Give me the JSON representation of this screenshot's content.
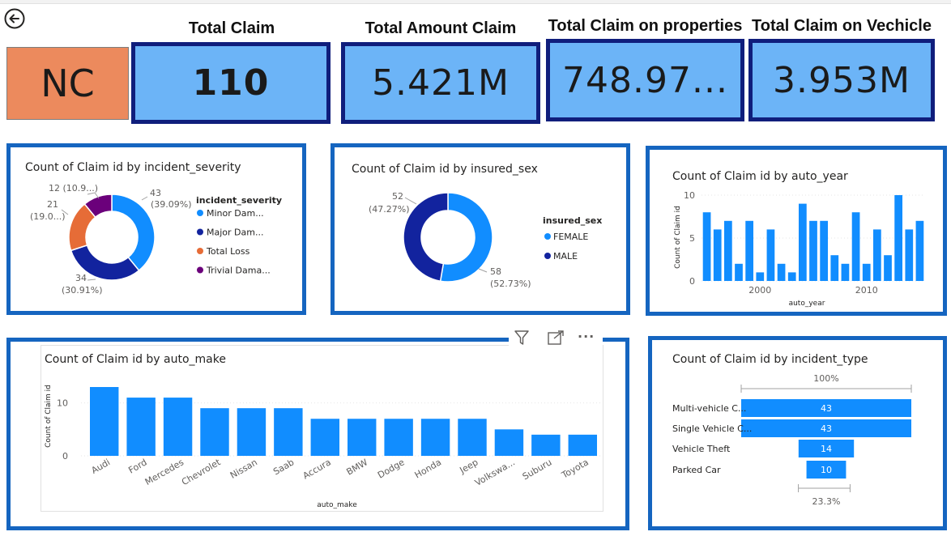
{
  "header": {
    "back_icon": "back-arrow-icon",
    "region": "NC",
    "kpis": [
      {
        "title": "Total Claim",
        "value": "110"
      },
      {
        "title": "Total Amount Claim",
        "value": "5.421M"
      },
      {
        "title": "Total Claim on properties",
        "value": "748.97..."
      },
      {
        "title": "Total Claim on Vechicle",
        "value": "3.953M"
      }
    ]
  },
  "colors": {
    "kpi_fill": "#6cb4f7",
    "kpi_border": "#101e7c",
    "panel_border": "#1565c0",
    "bar": "#118dff",
    "region_fill": "#ec8a5d"
  },
  "visual_header": {
    "filter_icon": "filter-icon",
    "focus_icon": "focus-mode-icon",
    "more_icon": "more-options-icon",
    "more_label": "..."
  },
  "chart_data": [
    {
      "type": "pie",
      "title": "Count of Claim id by incident_severity",
      "legend_title": "incident_severity",
      "legend_position": "right",
      "categories": [
        "Minor Dam...",
        "Major Dam...",
        "Total Loss",
        "Trivial Dama..."
      ],
      "values": [
        43,
        34,
        21,
        12
      ],
      "percent_labels": [
        "(39.09%)",
        "(30.91%)",
        "(19.0...)",
        "12 (10.9...)"
      ],
      "colors": [
        "#118dff",
        "#12239e",
        "#e66c37",
        "#6b007b"
      ]
    },
    {
      "type": "pie",
      "title": "Count of Claim id by insured_sex",
      "legend_title": "insured_sex",
      "legend_position": "right",
      "categories": [
        "FEMALE",
        "MALE"
      ],
      "values": [
        58,
        52
      ],
      "percent_labels": [
        "(52.73%)",
        "(47.27%)"
      ],
      "colors": [
        "#118dff",
        "#12239e"
      ]
    },
    {
      "type": "bar",
      "title": "Count of Claim id by auto_year",
      "xlabel": "auto_year",
      "ylabel": "Count of Claim id",
      "x": [
        1995,
        1996,
        1997,
        1998,
        1999,
        2000,
        2001,
        2002,
        2003,
        2004,
        2005,
        2006,
        2007,
        2008,
        2009,
        2010,
        2011,
        2012,
        2013,
        2014,
        2015
      ],
      "values": [
        8,
        6,
        7,
        2,
        7,
        1,
        6,
        2,
        1,
        9,
        7,
        7,
        3,
        2,
        8,
        2,
        6,
        3,
        10,
        6,
        7
      ],
      "xticks": [
        2000,
        2010
      ],
      "yticks": [
        0,
        5,
        10
      ],
      "ylim": [
        0,
        10
      ]
    },
    {
      "type": "bar",
      "title": "Count of Claim id by auto_make",
      "xlabel": "auto_make",
      "ylabel": "Count of Claim id",
      "categories": [
        "Audi",
        "Ford",
        "Mercedes",
        "Chevrolet",
        "Nissan",
        "Saab",
        "Accura",
        "BMW",
        "Dodge",
        "Honda",
        "Jeep",
        "Volkswa...",
        "Suburu",
        "Toyota"
      ],
      "values": [
        13,
        11,
        11,
        9,
        9,
        9,
        7,
        7,
        7,
        7,
        7,
        5,
        4,
        4
      ],
      "yticks": [
        0,
        10
      ],
      "ylim": [
        0,
        13
      ]
    },
    {
      "type": "bar",
      "subtype": "funnel",
      "title": "Count of Claim id by incident_type",
      "categories": [
        "Multi-vehicle C...",
        "Single Vehicle C...",
        "Vehicle Theft",
        "Parked Car"
      ],
      "values": [
        43,
        43,
        14,
        10
      ],
      "top_label": "100%",
      "bottom_label": "23.3%"
    }
  ]
}
